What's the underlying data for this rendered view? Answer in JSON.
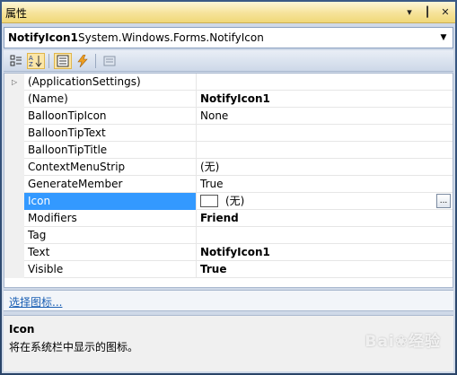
{
  "window": {
    "title": "属性"
  },
  "titlebar_buttons": {
    "dropdown": "▾",
    "pin": "┃",
    "close": "✕"
  },
  "object_selector": {
    "name": "NotifyIcon1",
    "type": "System.Windows.Forms.NotifyIcon"
  },
  "toolbar": {
    "items": [
      {
        "icon": "categorized-icon",
        "active": false
      },
      {
        "icon": "alphabetical-icon",
        "active": true
      },
      {
        "icon": "properties-icon",
        "active": true
      },
      {
        "icon": "events-icon",
        "active": false
      },
      {
        "icon": "property-pages-icon",
        "active": false
      }
    ]
  },
  "properties": [
    {
      "name": "(ApplicationSettings)",
      "value": "",
      "bold": false,
      "expandable": true
    },
    {
      "name": "(Name)",
      "value": "NotifyIcon1",
      "bold": true
    },
    {
      "name": "BalloonTipIcon",
      "value": "None",
      "bold": false
    },
    {
      "name": "BalloonTipText",
      "value": "",
      "bold": false
    },
    {
      "name": "BalloonTipTitle",
      "value": "",
      "bold": false
    },
    {
      "name": "ContextMenuStrip",
      "value": "(无)",
      "bold": false
    },
    {
      "name": "GenerateMember",
      "value": "True",
      "bold": false
    },
    {
      "name": "Icon",
      "value": "(无)",
      "bold": false,
      "selected": true
    },
    {
      "name": "Modifiers",
      "value": "Friend",
      "bold": true
    },
    {
      "name": "Tag",
      "value": "",
      "bold": false
    },
    {
      "name": "Text",
      "value": "NotifyIcon1",
      "bold": true
    },
    {
      "name": "Visible",
      "value": "True",
      "bold": true
    }
  ],
  "icon_row": {
    "ellipsis": "..."
  },
  "commands": {
    "link": "选择图标..."
  },
  "description": {
    "title": "Icon",
    "text": "将在系统栏中显示的图标。"
  },
  "watermark": {
    "text": "Bai❀经验"
  },
  "colors": {
    "selection": "#3399ff",
    "titlebar": "#f6e39a",
    "link": "#1a5fb4"
  }
}
